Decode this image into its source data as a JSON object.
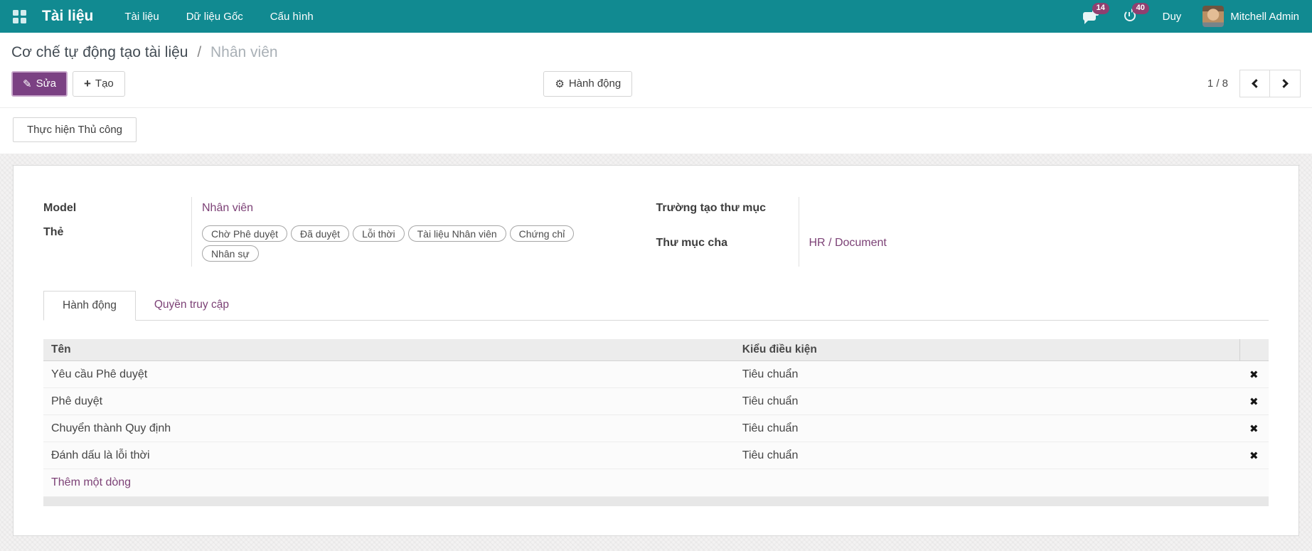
{
  "colors": {
    "navbar_bg": "#118a91",
    "primary_button": "#7b4183",
    "badge_bg": "#8f4070",
    "link": "#7c4176"
  },
  "navbar": {
    "app_title": "Tài liệu",
    "menu_items": [
      {
        "label": "Tài liệu"
      },
      {
        "label": "Dữ liệu Gốc"
      },
      {
        "label": "Cấu hình"
      }
    ],
    "messages_badge": "14",
    "activities_badge": "40",
    "company_name": "Duy",
    "user_name": "Mitchell Admin"
  },
  "breadcrumb": {
    "parent": "Cơ chế tự động tạo tài liệu",
    "separator": "/",
    "current": "Nhân viên"
  },
  "buttons": {
    "edit": "Sửa",
    "create": "Tạo",
    "action": "Hành động",
    "manual_run": "Thực hiện Thủ công"
  },
  "icons": {
    "edit_pencil": "✎",
    "create_plus": "+",
    "action_gear": "⚙",
    "delete_cross": "✖"
  },
  "pager": {
    "value": "1 / 8"
  },
  "form": {
    "left": {
      "model_label": "Model",
      "model_value": "Nhân viên",
      "tags_label": "Thẻ",
      "tags": [
        {
          "label": "Chờ Phê duyệt"
        },
        {
          "label": "Đã duyệt"
        },
        {
          "label": "Lỗi thời"
        },
        {
          "label": "Tài liệu Nhân viên"
        },
        {
          "label": "Chứng chỉ"
        },
        {
          "label": "Nhân sự"
        }
      ]
    },
    "right": {
      "folder_field_label": "Trường tạo thư mục",
      "folder_field_value": "",
      "parent_folder_label": "Thư mục cha",
      "parent_folder_value": "HR / Document"
    }
  },
  "tabs": [
    {
      "label": "Hành động",
      "active": true
    },
    {
      "label": "Quyền truy cập",
      "active": false
    }
  ],
  "table": {
    "headers": [
      {
        "label": "Tên"
      },
      {
        "label": "Kiểu điều kiện"
      }
    ],
    "rows": [
      {
        "name": "Yêu cầu Phê duyệt",
        "condition": "Tiêu chuẩn"
      },
      {
        "name": "Phê duyệt",
        "condition": "Tiêu chuẩn"
      },
      {
        "name": "Chuyển thành Quy định",
        "condition": "Tiêu chuẩn"
      },
      {
        "name": "Đánh dấu là lỗi thời",
        "condition": "Tiêu chuẩn"
      }
    ],
    "add_row_label": "Thêm một dòng"
  }
}
